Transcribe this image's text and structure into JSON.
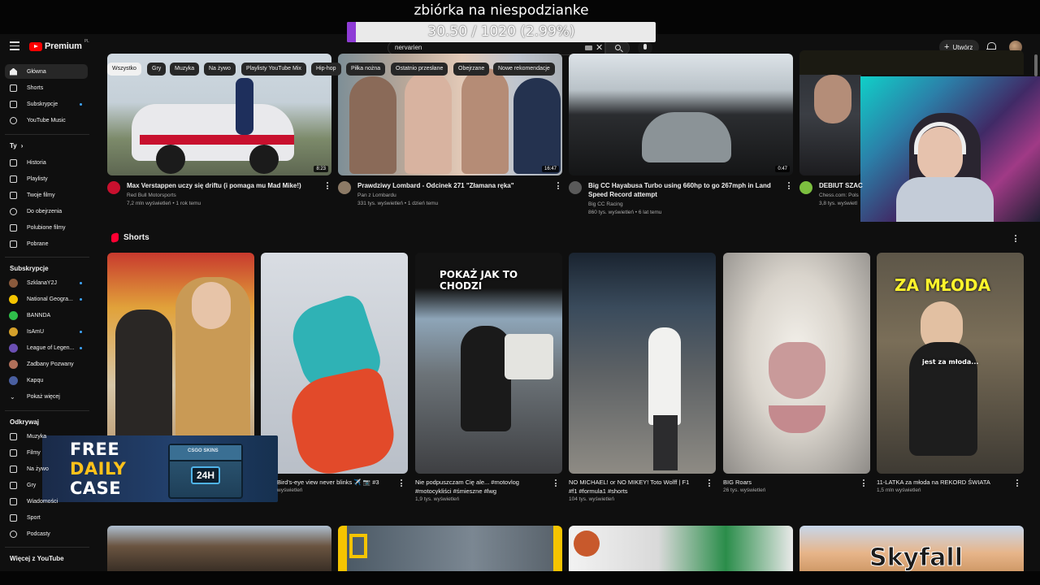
{
  "overlay": {
    "goal_title": "zbiórka na niespodzianke",
    "goal_text": "30.50 / 1020 (2.99%)",
    "goal_fraction": 0.0299,
    "goal_color": "#8e3bd6"
  },
  "header": {
    "logo_text": "Premium",
    "logo_sup": "PL",
    "search_value": "nervarien",
    "create_label": "Utwórz"
  },
  "sidebar": {
    "main": [
      {
        "label": "Główna",
        "icon": "home-icon"
      },
      {
        "label": "Shorts",
        "icon": "shorts-icon"
      },
      {
        "label": "Subskrypcje",
        "icon": "subscriptions-icon"
      },
      {
        "label": "YouTube Music",
        "icon": "music-icon"
      }
    ],
    "you_heading": "Ty",
    "you_chevron": "›",
    "you": [
      {
        "label": "Historia",
        "icon": "history-icon"
      },
      {
        "label": "Playlisty",
        "icon": "playlists-icon"
      },
      {
        "label": "Twoje filmy",
        "icon": "your-videos-icon"
      },
      {
        "label": "Do obejrzenia",
        "icon": "watch-later-icon"
      },
      {
        "label": "Polubione filmy",
        "icon": "liked-icon"
      },
      {
        "label": "Pobrane",
        "icon": "download-icon"
      }
    ],
    "subs_heading": "Subskrypcje",
    "subs": [
      {
        "label": "SzklanaY2J",
        "color": "#8a5a3c",
        "dot": true
      },
      {
        "label": "National Geogra...",
        "color": "#f5c400",
        "dot": true
      },
      {
        "label": "BANNDA",
        "color": "#2fbf4a",
        "dot": false
      },
      {
        "label": "IsAmU",
        "color": "#d4a02a",
        "dot": true
      },
      {
        "label": "League of Legen...",
        "color": "#6b4fb3",
        "dot": true
      },
      {
        "label": "Zadbany Pozwany",
        "color": "#b0705a",
        "dot": false
      },
      {
        "label": "Kapqu",
        "color": "#4a5fa0",
        "dot": false
      }
    ],
    "show_more": "Pokaż więcej",
    "explore_heading": "Odkrywaj",
    "explore": [
      {
        "label": "Muzyka",
        "icon": "music-note-icon"
      },
      {
        "label": "Filmy",
        "icon": "film-icon"
      },
      {
        "label": "Na żywo",
        "icon": "live-icon"
      },
      {
        "label": "Gry",
        "icon": "gaming-icon"
      },
      {
        "label": "Wiadomości",
        "icon": "news-icon"
      },
      {
        "label": "Sport",
        "icon": "trophy-icon"
      },
      {
        "label": "Podcasty",
        "icon": "podcast-icon"
      }
    ],
    "more_heading": "Więcej z YouTube"
  },
  "chips": [
    "Wszystko",
    "Gry",
    "Muzyka",
    "Na żywo",
    "Playlisty YouTube Mix",
    "Hip-hop",
    "Piłka nożna",
    "Ostatnio przesłane",
    "Obejrzane",
    "Nowe rekomendacje"
  ],
  "videos": [
    {
      "title": "Max Verstappen uczy się driftu (i pomaga mu Mad Mike!)",
      "channel": "Red Bull Motorsports",
      "meta": "7,2 mln wyświetleń • 1 rok temu",
      "duration": "8:23",
      "avatar_color": "#c8102e"
    },
    {
      "title": "Prawdziwy Lombard - Odcinek 271 \"Złamana ręka\"",
      "channel": "Pan z Lombardu",
      "meta": "331 tys. wyświetleń • 1 dzień temu",
      "duration": "16:47",
      "avatar_color": "#8c7a66"
    },
    {
      "title": "Big CC Hayabusa Turbo using 660hp to go 267mph in Land Speed Record attempt",
      "channel": "Big CC Racing",
      "meta": "860 tys. wyświetleń • 6 lat temu",
      "duration": "0:47",
      "avatar_color": "#5a5a5a"
    },
    {
      "title": "DEBIUT SZACI",
      "channel": "Chess.com: Pols",
      "meta": "3,8 tys. wyświetl",
      "duration": "",
      "avatar_color": "#7cbf3f"
    }
  ],
  "shorts": {
    "heading": "Shorts",
    "items": [
      {
        "title": "",
        "views": ""
      },
      {
        "title": "Bird's-eye view never blinks ✈️ 📷 #3",
        "views": "wyświetleń"
      },
      {
        "title": "Nie podpuszczam Cię ale... #motovlog #motocykliści #śmieszne #lwg",
        "views": "1,9 tys. wyświetleń",
        "caption": "POKAŻ JAK TO CHODZI"
      },
      {
        "title": "NO MICHAEL! or NO MIKEY! Toto Wolff | F1 #f1 #formula1 #shorts",
        "views": "104 tys. wyświetleń"
      },
      {
        "title": "BIG Roars",
        "views": "26 tys. wyświetleń"
      },
      {
        "title": "11-LATKA za młoda na REKORD ŚWIATA",
        "views": "1,5 mln wyświetleń",
        "caption": "ZA MŁODA",
        "subcaption": "jest za młoda..."
      }
    ]
  },
  "promo": {
    "line1": "FREE",
    "line2": "DAILY",
    "line3": "CASE",
    "crate_brand": "CSGO SKINS",
    "crate_label": "24H"
  },
  "bottom_row": {
    "skyfall_caption": "Skyfall"
  }
}
